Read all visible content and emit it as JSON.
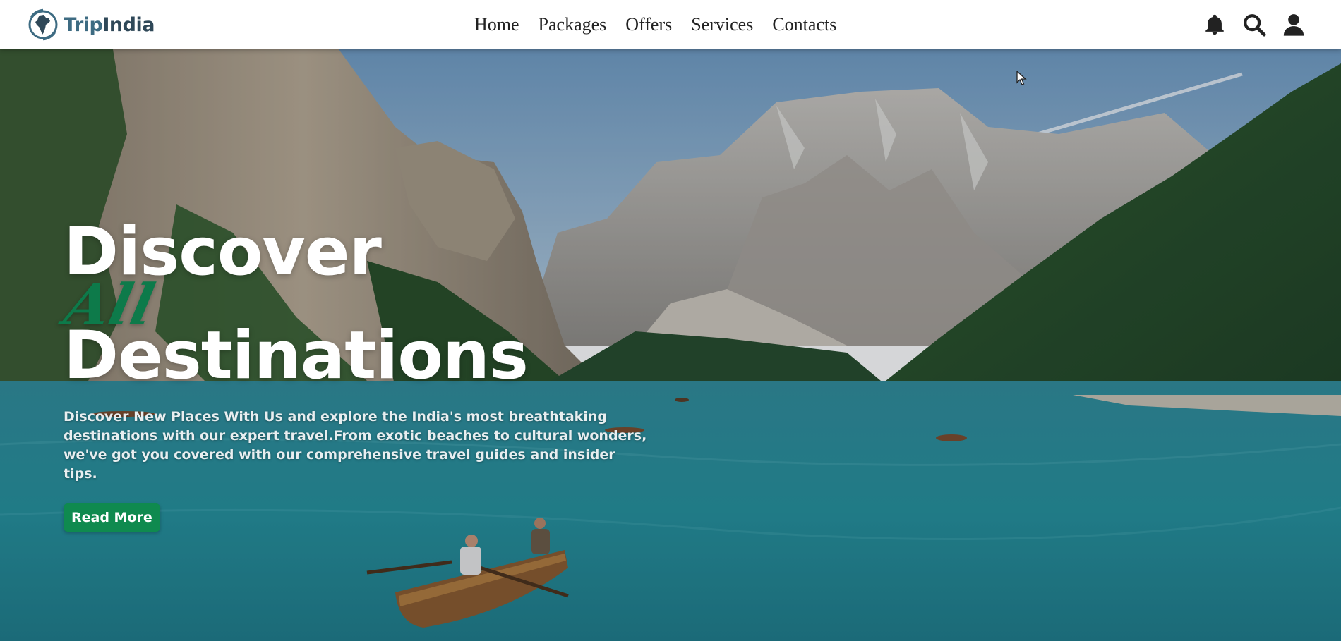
{
  "brand": {
    "name_part1": "Trip",
    "name_part2": "India",
    "logo_icon": "india-map-globe-icon"
  },
  "nav": {
    "links": [
      {
        "label": "Home"
      },
      {
        "label": "Packages"
      },
      {
        "label": "Offers"
      },
      {
        "label": "Services"
      },
      {
        "label": "Contacts"
      }
    ],
    "icons": [
      "bell-icon",
      "search-icon",
      "user-icon"
    ]
  },
  "hero": {
    "title_line1": "Discover",
    "title_accent": "All",
    "title_line2": "Destinations",
    "description": "Discover New Places With Us and explore the India's most breathtaking destinations with our expert travel.From exotic beaches to cultural wonders, we've got you covered with our comprehensive travel guides and insider tips.",
    "button_label": "Read More"
  },
  "colors": {
    "accent_green": "#0f8a4f",
    "title_accent_green": "#0d7a4a",
    "brand_blue": "#3d6b82",
    "brand_dark": "#2f4858",
    "navbar_bg": "#ffffff"
  }
}
